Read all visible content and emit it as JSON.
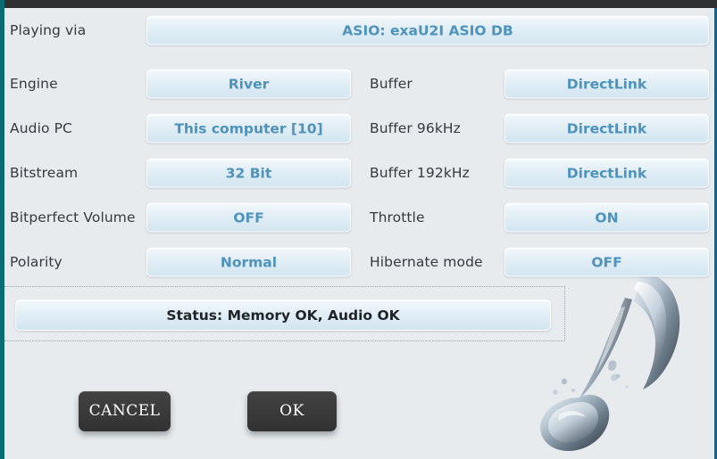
{
  "window": {
    "titlebar_color": "#2f3032",
    "left_edge_color": "#0b6b73",
    "right_edge_color": "#1c5f86",
    "background_color": "#e8ebee",
    "accent_value_color": "#4e93bd",
    "label_color": "#343a3f"
  },
  "playing_via": {
    "label": "Playing via",
    "value": "ASIO: exaU2I ASIO DB"
  },
  "settings_left": [
    {
      "label": "Engine",
      "value": "River"
    },
    {
      "label": "Audio PC",
      "value": "This computer [10]"
    },
    {
      "label": "Bitstream",
      "value": "32 Bit"
    },
    {
      "label": "Bitperfect Volume",
      "value": "OFF"
    },
    {
      "label": "Polarity",
      "value": "Normal"
    }
  ],
  "settings_right": [
    {
      "label": "Buffer",
      "value": "DirectLink"
    },
    {
      "label": "Buffer 96kHz",
      "value": "DirectLink"
    },
    {
      "label": "Buffer 192kHz",
      "value": "DirectLink"
    },
    {
      "label": "Throttle",
      "value": "ON"
    },
    {
      "label": "Hibernate mode",
      "value": "OFF"
    }
  ],
  "status": {
    "text": "Status: Memory OK, Audio OK"
  },
  "actions": {
    "cancel_label": "CANCEL",
    "ok_label": "OK"
  },
  "artwork": {
    "name": "water-splash-music-note"
  }
}
